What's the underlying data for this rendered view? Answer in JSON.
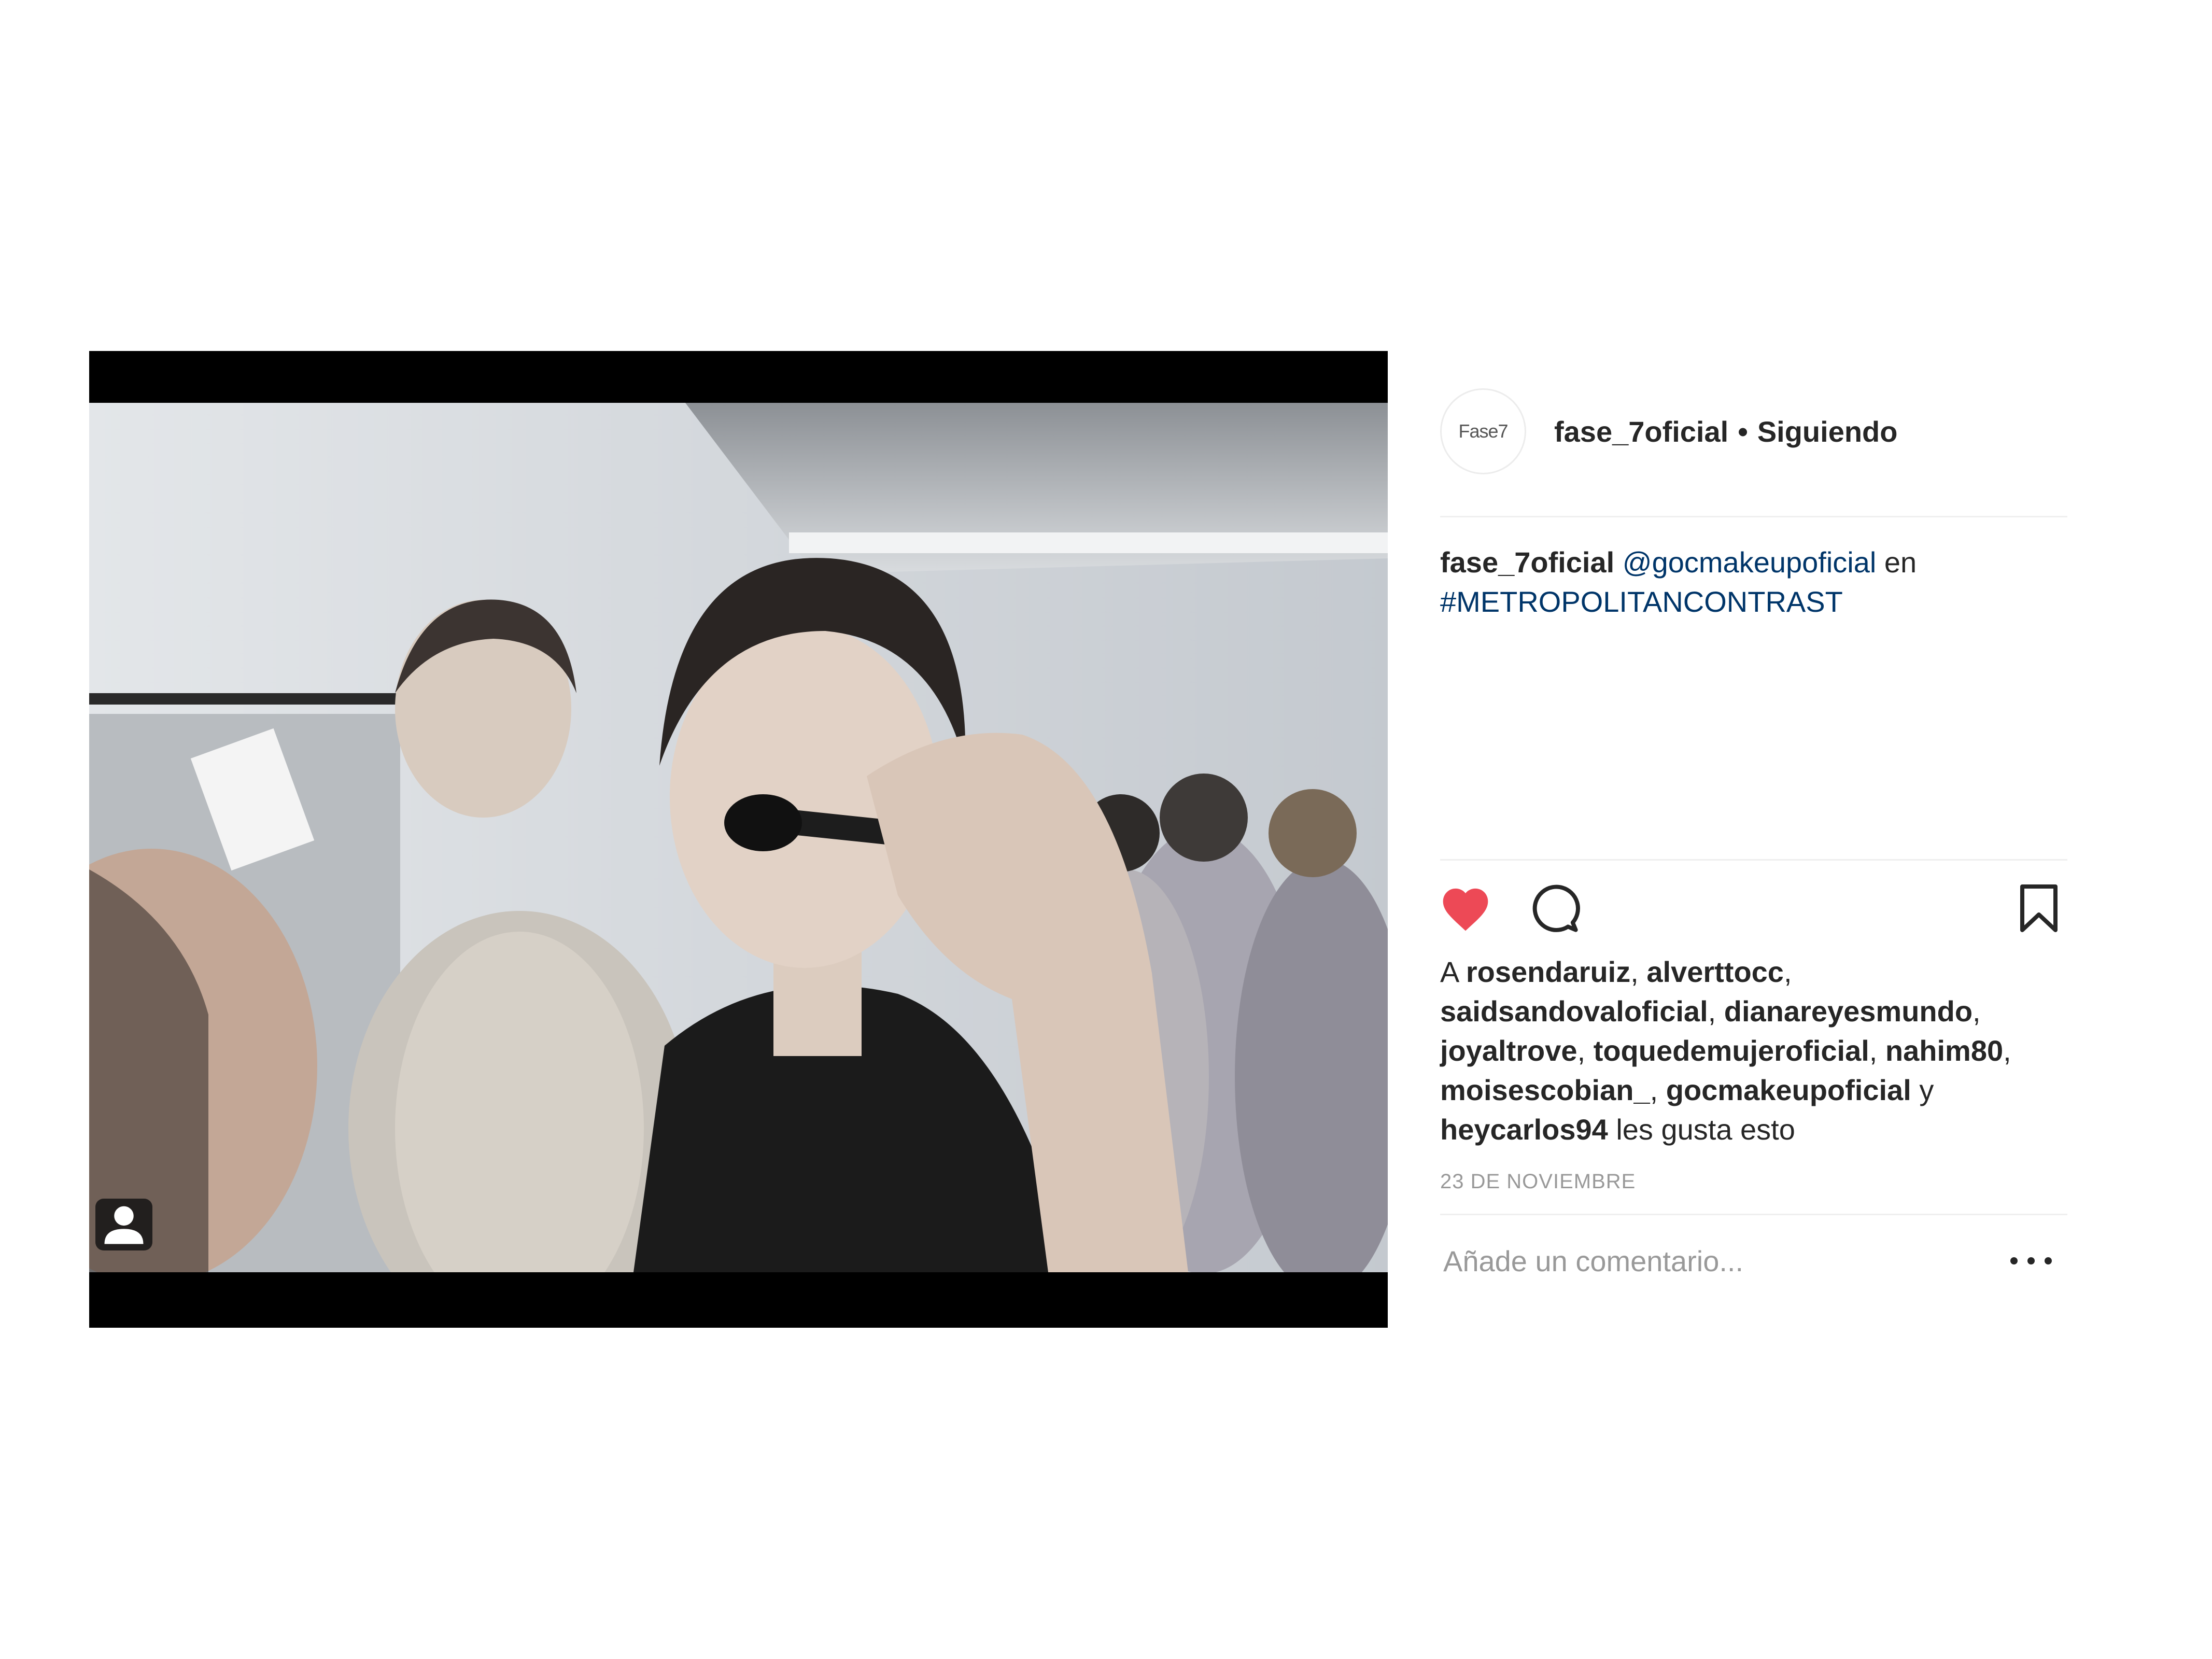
{
  "post": {
    "photo_alt": "",
    "tag_badge_icon": "user-tag-icon"
  },
  "header": {
    "avatar_text": "Fase7",
    "username": "fase_7oficial",
    "separator": "•",
    "follow_status": "Siguiendo"
  },
  "caption": {
    "username": "fase_7oficial",
    "mention": "@gocmakeupoficial",
    "connector": " en ",
    "hashtag": "#METROPOLITANCONTRAST"
  },
  "actions": {
    "like_icon": "heart-filled-icon",
    "comment_icon": "comment-icon",
    "save_icon": "bookmark-icon",
    "like_color": "#ed4956"
  },
  "likes": {
    "prefix": "A ",
    "users": [
      "rosendaruiz",
      "alverttocc",
      "saidsandovaloficial",
      "dianareyesmundo",
      "joyaltrove",
      "toquedemujeroficial",
      "nahim80",
      "moisescobian_",
      "gocmakeupoficial"
    ],
    "comma": ", ",
    "and": " y ",
    "last_user": "heycarlos94",
    "suffix": " les gusta esto"
  },
  "date": "23 DE NOVIEMBRE",
  "comment": {
    "placeholder": "Añade un comentario...",
    "more_icon": "more-options-icon"
  },
  "colors": {
    "link": "#003569",
    "text": "#262626",
    "muted": "#999999",
    "divider": "#efefef"
  }
}
